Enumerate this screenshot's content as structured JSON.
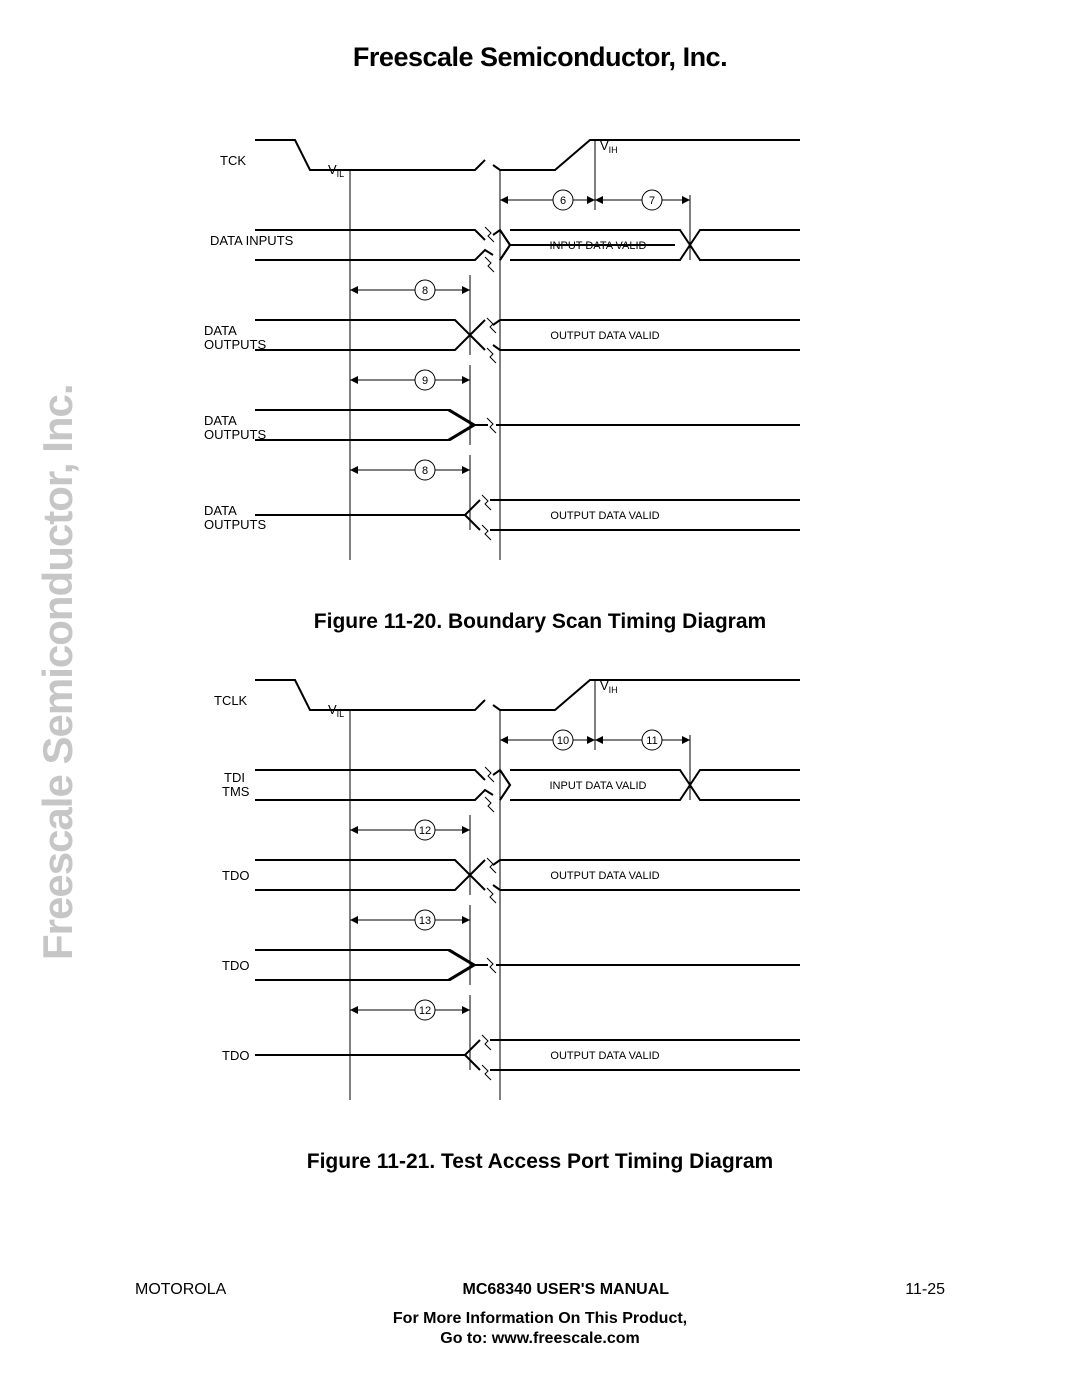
{
  "header": "Freescale Semiconductor, Inc.",
  "watermark": "Freescale Semiconductor, Inc.",
  "fig1": {
    "caption": "Figure 11-20. Boundary Scan Timing Diagram",
    "signals": {
      "clk": "TCK",
      "vil": "V",
      "vil_sub": "IL",
      "vih": "V",
      "vih_sub": "IH",
      "din": "DATA\nINPUTS",
      "dout1": "DATA\nOUTPUTS",
      "dout2": "DATA\nOUTPUTS",
      "dout3": "DATA\nOUTPUTS",
      "in_valid": "INPUT DATA VALID",
      "out_valid1": "OUTPUT DATA VALID",
      "out_valid3": "OUTPUT DATA VALID",
      "m6": "6",
      "m7": "7",
      "m8a": "8",
      "m9": "9",
      "m8b": "8"
    }
  },
  "fig2": {
    "caption": "Figure 11-21. Test Access Port Timing Diagram",
    "signals": {
      "clk": "TCLK",
      "vil": "V",
      "vil_sub": "IL",
      "vih": "V",
      "vih_sub": "IH",
      "din": "TDI\nTMS",
      "dout1": "TDO",
      "dout2": "TDO",
      "dout3": "TDO",
      "in_valid": "INPUT DATA VALID",
      "out_valid1": "OUTPUT DATA VALID",
      "out_valid3": "OUTPUT DATA VALID",
      "m10": "10",
      "m11": "11",
      "m12a": "12",
      "m13": "13",
      "m12b": "12"
    }
  },
  "footer": {
    "left": "MOTOROLA",
    "center": "MC68340 USER'S MANUAL",
    "right": "11-25",
    "line1": "For More Information On This Product,",
    "line2": "Go to: www.freescale.com"
  }
}
